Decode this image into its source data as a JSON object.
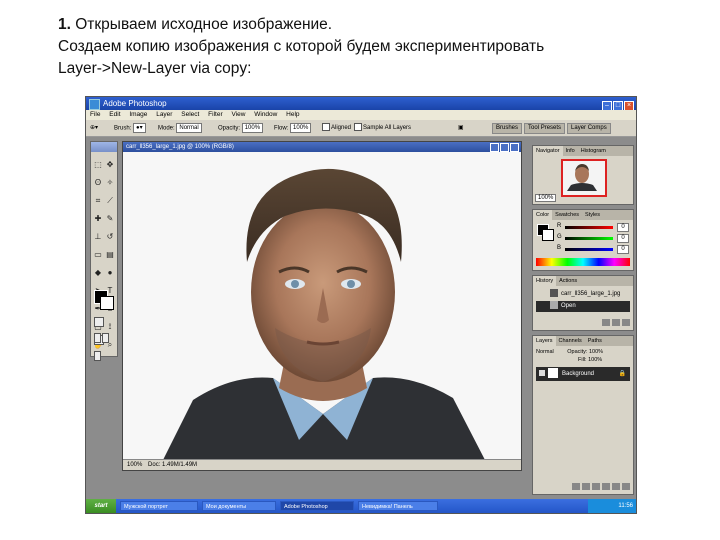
{
  "caption": {
    "number": "1.",
    "line1": "Открываем исходное изображение.",
    "line2": "Создаем копию изображения с которой будем экспериментировать",
    "line3": "Layer->New-Layer via copy:"
  },
  "app": {
    "title": "Adobe Photoshop",
    "menu": [
      "File",
      "Edit",
      "Image",
      "Layer",
      "Select",
      "Filter",
      "View",
      "Window",
      "Help"
    ]
  },
  "options": {
    "brush_label": "Brush:",
    "mode_label": "Mode:",
    "mode_value": "Normal",
    "opacity_label": "Opacity:",
    "opacity_value": "100%",
    "flow_label": "Flow:",
    "flow_value": "100%",
    "aligned_label": "Aligned",
    "sample_label": "Sample All Layers",
    "palette_tabs": [
      "Brushes",
      "Tool Presets",
      "Layer Comps"
    ]
  },
  "document": {
    "title": "carr_ll356_large_1.jpg @ 100% (RGB/8)",
    "zoom": "100%",
    "doc_info": "Doc: 1.49M/1.49M"
  },
  "navigator": {
    "tabs": [
      "Navigator",
      "Info",
      "Histogram"
    ],
    "zoom": "100%"
  },
  "color_panel": {
    "tabs": [
      "Color",
      "Swatches",
      "Styles"
    ],
    "rows": [
      {
        "label": "R",
        "value": "0"
      },
      {
        "label": "G",
        "value": "0"
      },
      {
        "label": "B",
        "value": "0"
      }
    ]
  },
  "history": {
    "tabs": [
      "History",
      "Actions"
    ],
    "items": [
      {
        "label": "carr_ll356_large_1.jpg"
      },
      {
        "label": "Open"
      }
    ]
  },
  "layers": {
    "tabs": [
      "Layers",
      "Channels",
      "Paths"
    ],
    "blend": "Normal",
    "opacity_label": "Opacity: 100%",
    "fill_label": "Fill: 100%",
    "layer_name": "Background"
  },
  "taskbar": {
    "start_label": "start",
    "tasks": [
      "Мужской портрет",
      "Мои документы",
      "Adobe Photoshop",
      "Невидимка! Панель"
    ],
    "clock": "11:56"
  },
  "colors": {
    "titlebar": "#1a44a8",
    "taskbar": "#2456c8",
    "highlight": "#d22222"
  }
}
